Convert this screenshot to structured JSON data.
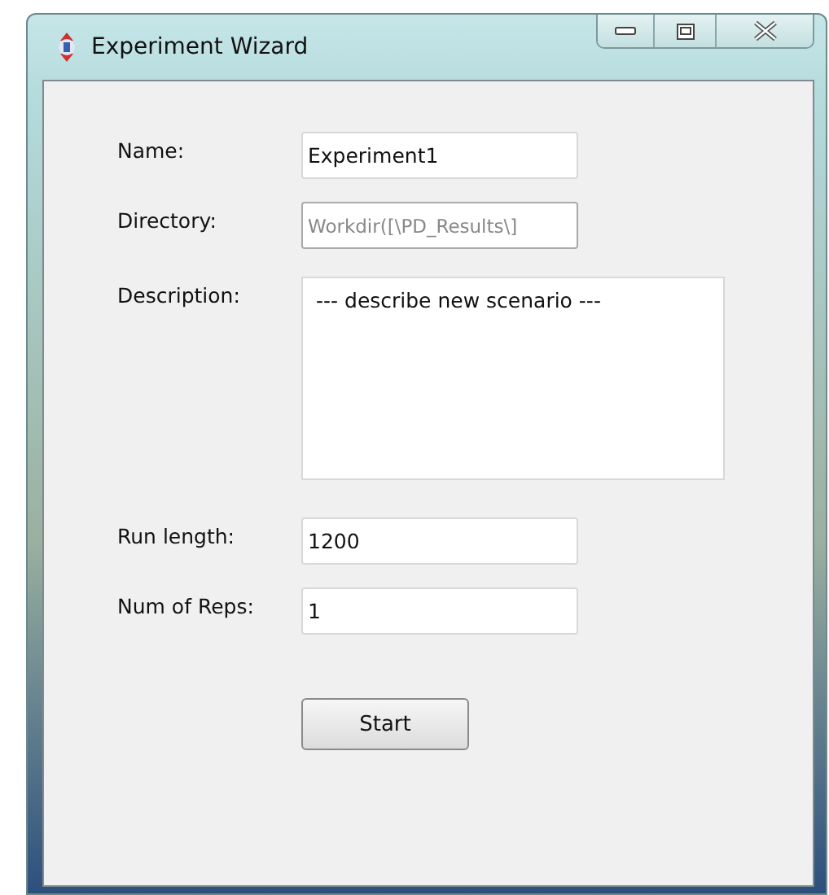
{
  "window": {
    "title": "Experiment Wizard"
  },
  "fields": [
    {
      "label": "Name:",
      "value": "Experiment1",
      "kind": "text",
      "disabled": false
    },
    {
      "label": "Directory:",
      "value": "Workdir([\\PD_Results\\]",
      "kind": "text",
      "disabled": true
    },
    {
      "label": "Description:",
      "value": "--- describe new scenario ---",
      "kind": "textarea",
      "disabled": false
    },
    {
      "label": "Run length:",
      "value": "1200",
      "kind": "text",
      "disabled": false
    },
    {
      "label": "Num of Reps:",
      "value": "1",
      "kind": "text",
      "disabled": false
    }
  ],
  "buttons": [
    "Start"
  ]
}
